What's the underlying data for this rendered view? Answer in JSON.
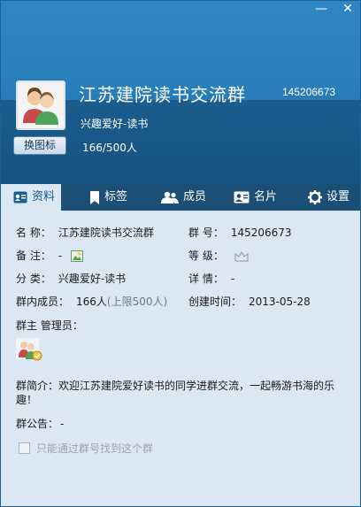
{
  "window": {
    "minimize_glyph": "—",
    "close_glyph": "✕"
  },
  "header": {
    "group_name": "江苏建院读书交流群",
    "group_id": "145206673",
    "category": "兴趣爱好-读书",
    "member_count": "166/500人",
    "change_icon_label": "换图标"
  },
  "tabs": [
    {
      "label": "资料",
      "icon": "profile-card-icon"
    },
    {
      "label": "标签",
      "icon": "bookmark-icon"
    },
    {
      "label": "成员",
      "icon": "members-icon"
    },
    {
      "label": "名片",
      "icon": "namecard-icon"
    },
    {
      "label": "设置",
      "icon": "gear-icon"
    }
  ],
  "info": {
    "name_label": "名   称：",
    "name_value": "江苏建院读书交流群",
    "number_label": "群   号：",
    "number_value": "145206673",
    "remark_label": "备   注：",
    "remark_value": "-",
    "level_label": "等   级：",
    "class_label": "分   类：",
    "class_value": "兴趣爱好-读书",
    "detail_label": "详   情：",
    "detail_value": "-",
    "members_label": "群内成员：",
    "members_value": "166人",
    "members_limit": "(上限500人)",
    "created_label": "创建时间：",
    "created_value": "2013-05-28",
    "admins_label": "群主 管理员：",
    "intro_label": "群简介：",
    "intro_value": "欢迎江苏建院爱好读书的同学进群交流，一起畅游书海的乐趣！",
    "notice_label": "群公告：",
    "notice_value": "-",
    "search_option_label": "只能通过群号找到这个群"
  },
  "colors": {
    "header_blue": "#2a7fba",
    "tab_bar": "#1b4f76",
    "content_bg": "#dbe8f4"
  }
}
